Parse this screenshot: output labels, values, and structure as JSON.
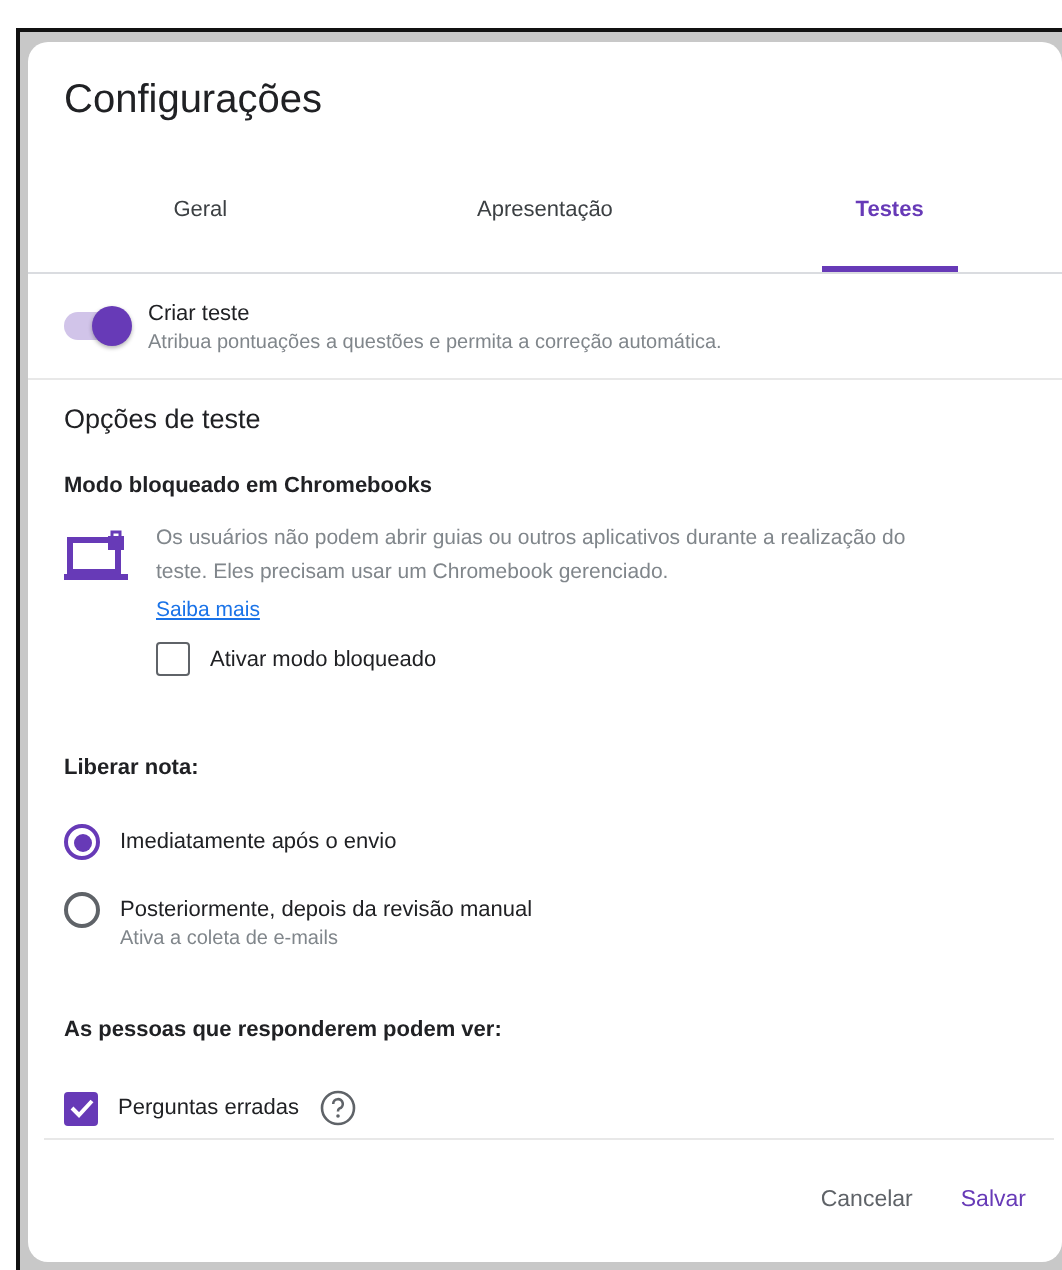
{
  "dialog": {
    "title": "Configurações"
  },
  "tabs": [
    {
      "label": "Geral",
      "selected": false
    },
    {
      "label": "Apresentação",
      "selected": false
    },
    {
      "label": "Testes",
      "selected": true
    }
  ],
  "quiz_toggle": {
    "label": "Criar teste",
    "description": "Atribua pontuações a questões e permita a correção automática.",
    "on": true
  },
  "section_title": "Opções de teste",
  "locked_mode": {
    "heading": "Modo bloqueado em Chromebooks",
    "description": "Os usuários não podem abrir guias ou outros aplicativos durante a realização do teste. Eles precisam usar um Chromebook gerenciado.",
    "link": "Saiba mais",
    "checkbox": {
      "label": "Ativar modo bloqueado",
      "checked": false
    }
  },
  "release_grade": {
    "heading": "Liberar nota:",
    "options": [
      {
        "label": "Imediatamente após o envio",
        "selected": true
      },
      {
        "label": "Posteriormente, depois da revisão manual",
        "hint": "Ativa a coleta de e-mails",
        "selected": false
      }
    ]
  },
  "respondents_see": {
    "heading": "As pessoas que responderem podem ver:",
    "options": [
      {
        "label": "Perguntas erradas",
        "checked": true
      }
    ]
  },
  "buttons": [
    {
      "label": "Cancelar",
      "primary": false
    },
    {
      "label": "Salvar",
      "primary": true
    }
  ]
}
